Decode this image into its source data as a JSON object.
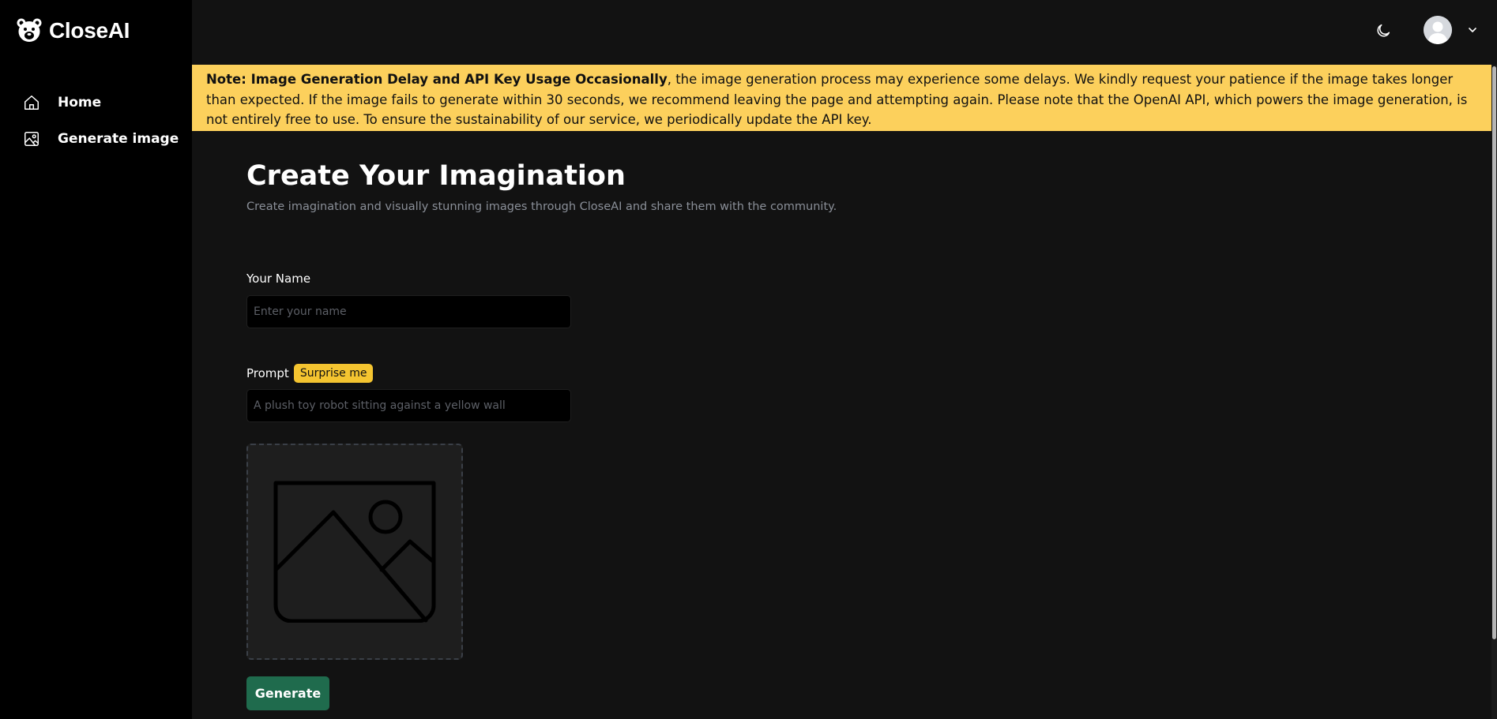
{
  "brand": {
    "name": "CloseAI",
    "logo_icon": "bear-icon"
  },
  "sidebar": {
    "items": [
      {
        "label": "Home",
        "icon": "home-icon"
      },
      {
        "label": "Generate image",
        "icon": "image-icon"
      }
    ]
  },
  "header": {
    "theme_toggle_icon": "moon-icon",
    "avatar_icon": "user-avatar-icon",
    "menu_icon": "chevron-down-icon"
  },
  "banner": {
    "strong": "Note: Image Generation Delay and API Key Usage Occasionally",
    "text": ", the image generation process may experience some delays. We kindly request your patience if the image takes longer than expected. If the image fails to generate within 30 seconds, we recommend leaving the page and attempting again. Please note that the OpenAI API, which powers the image generation, is not entirely free to use. To ensure the sustainability of our service, we periodically update the API key.",
    "background": "#fcd05c"
  },
  "main": {
    "title": "Create Your Imagination",
    "subtitle": "Create imagination and visually stunning images through CloseAI and share them with the community.",
    "name_field": {
      "label": "Your Name",
      "placeholder": "Enter your name",
      "value": ""
    },
    "prompt_field": {
      "label": "Prompt",
      "placeholder": "A plush toy robot sitting against a yellow wall",
      "value": ""
    },
    "surprise_button": "Surprise me",
    "preview_icon": "image-placeholder-icon",
    "generate_button": "Generate"
  },
  "colors": {
    "sidebar_bg": "#000000",
    "page_bg": "#121212",
    "accent_yellow": "#f4c430",
    "generate_green": "#1f6b4d"
  }
}
